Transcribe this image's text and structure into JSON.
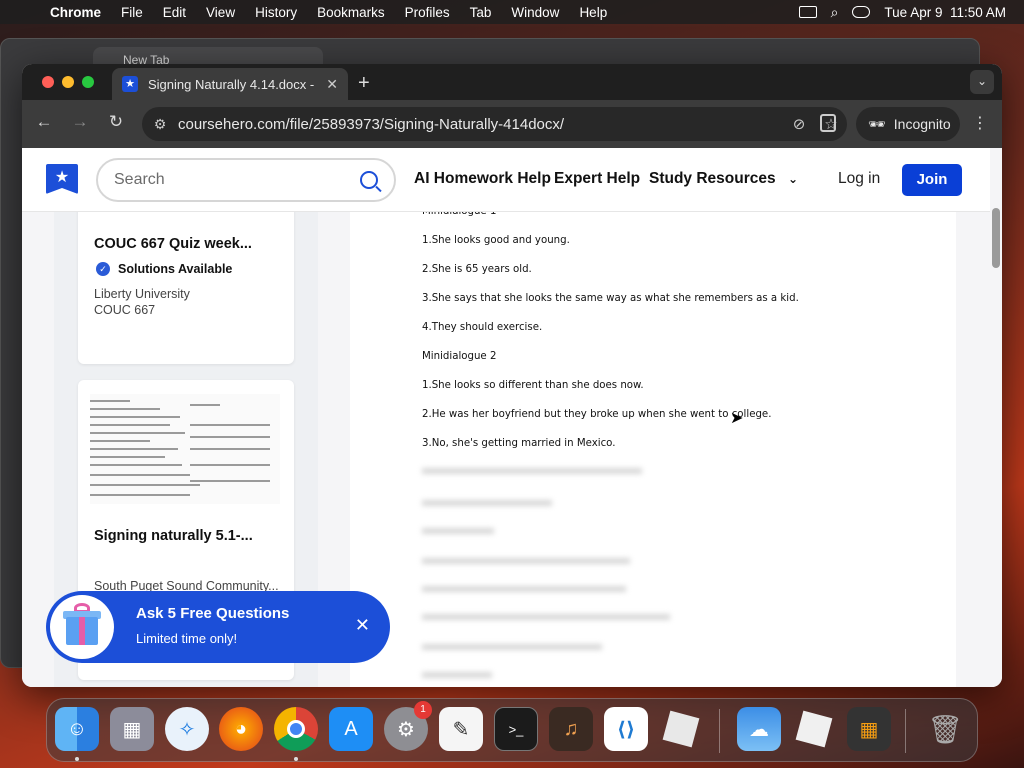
{
  "menubar": {
    "app": "Chrome",
    "items": [
      "File",
      "Edit",
      "View",
      "History",
      "Bookmarks",
      "Profiles",
      "Tab",
      "Window",
      "Help"
    ],
    "clock": "Tue Apr 9  11:50 AM"
  },
  "background_window": {
    "tab_title": "New Tab"
  },
  "browser": {
    "tab_title": "Signing Naturally 4.14.docx -",
    "url": "coursehero.com/file/25893973/Signing-Naturally-414docx/",
    "incognito_label": "Incognito"
  },
  "site": {
    "search_placeholder": "Search",
    "nav": [
      "AI Homework Help",
      "Expert Help",
      "Study Resources"
    ],
    "login": "Log in",
    "join": "Join"
  },
  "sidebar": {
    "card1": {
      "title": "COUC 667 Quiz week...",
      "badge": "Solutions Available",
      "school": "Liberty University",
      "course": "COUC 667"
    },
    "card2": {
      "title": "Signing naturally 5.1-...",
      "school": "South Puget Sound Community..."
    }
  },
  "document": {
    "lines": [
      "Minidialogue 1",
      "1.She looks good and young.",
      "2.She is 65 years old.",
      "3.She says that she looks the same way as what she remembers as a kid.",
      "4.They should exercise.",
      "Minidialogue 2",
      "1.She looks so different than she does now.",
      "2.He was her boyfriend but they broke up when she went to college.",
      "3.No, she's getting married in Mexico."
    ]
  },
  "promo": {
    "title": "Ask 5 Free Questions",
    "subtitle": "Limited time only!"
  },
  "dock": {
    "settings_badge": "1",
    "apps": [
      "finder-icon",
      "launchpad-icon",
      "safari-icon",
      "firefox-icon",
      "chrome-icon",
      "app-store-icon",
      "system-settings-icon",
      "textedit-icon",
      "terminal-icon",
      "garageband-icon",
      "vscode-icon",
      "roblox-icon",
      "weather-icon",
      "roblox-studio-icon",
      "calculator-icon",
      "trash-icon"
    ]
  }
}
